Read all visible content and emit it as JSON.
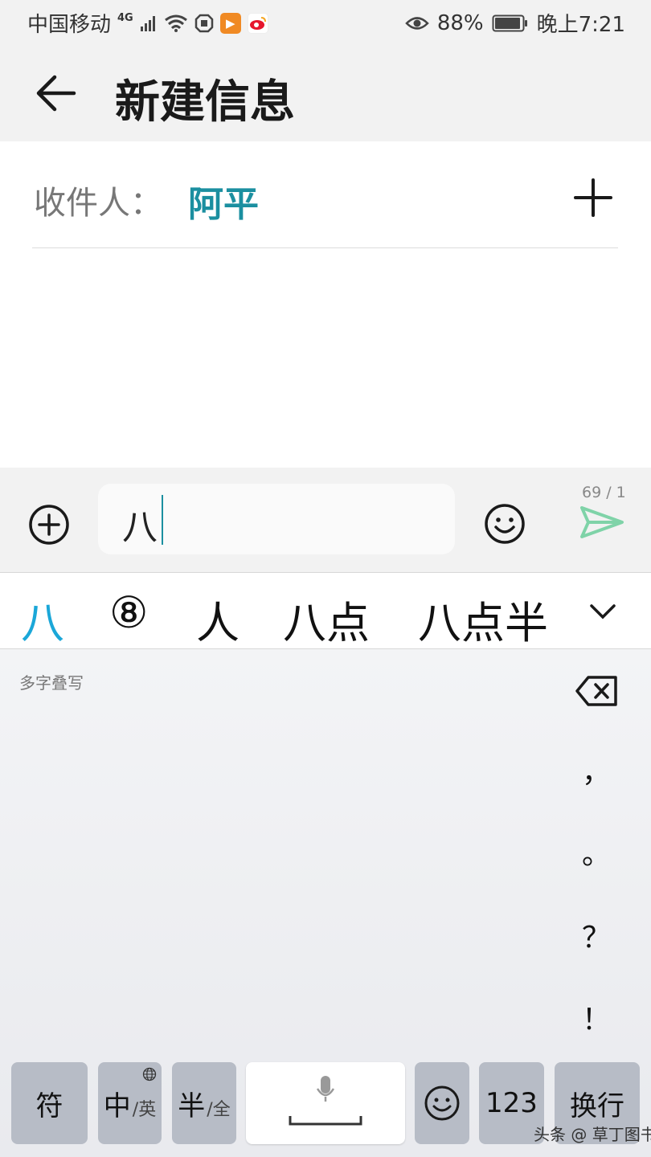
{
  "status_bar": {
    "carrier": "中国移动",
    "network": "4G",
    "battery_percent": "88%",
    "time": "晚上7:21"
  },
  "header": {
    "title": "新建信息"
  },
  "recipients": {
    "label": "收件人：",
    "name": "阿平"
  },
  "compose": {
    "text": "八",
    "counter": "69 / 1"
  },
  "candidates": [
    "八",
    "⑧",
    "人",
    "八点",
    "八点半"
  ],
  "keyboard": {
    "mode_label": "多字叠写",
    "punctuation": [
      "，",
      "。",
      "？",
      "！"
    ],
    "keys": {
      "symbol": "符",
      "lang_main": "中",
      "lang_sub": "/英",
      "width_main": "半",
      "width_sub": "/全",
      "numbers": "123",
      "enter": "换行"
    }
  },
  "watermark": "头条 @ 草丁图书馆",
  "colors": {
    "accent": "#1b8fa0",
    "candidate_active": "#1ba7d8",
    "send_icon": "#7fd3a8"
  }
}
